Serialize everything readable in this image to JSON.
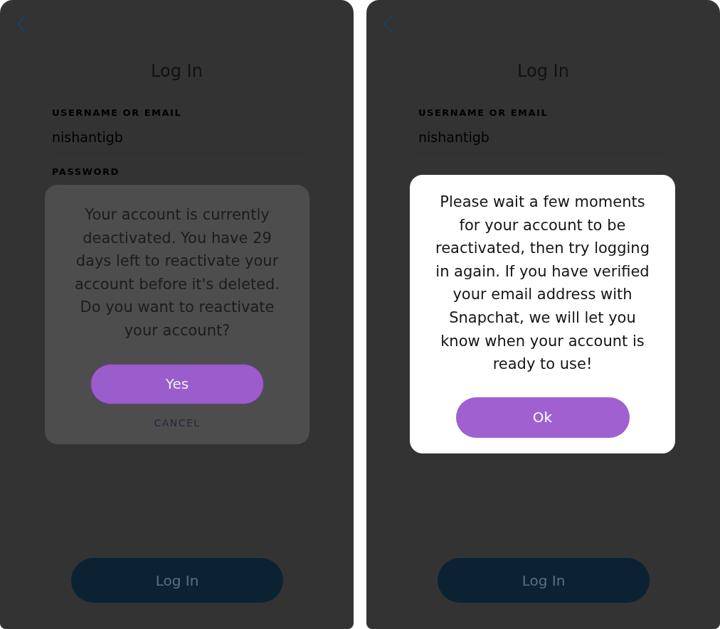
{
  "screens": [
    {
      "title": "Log In",
      "username_label": "USERNAME OR EMAIL",
      "username": "nishantigb",
      "password_label": "PASSWORD",
      "login_button": "Log In",
      "dialog": {
        "kind": "dimmed",
        "message": "Your account is currently deactivated. You have 29 days left to reactivate your account before it's deleted. Do you want to reactivate your account?",
        "primary_button": "Yes",
        "secondary_button": "CANCEL"
      }
    },
    {
      "title": "Log In",
      "username_label": "USERNAME OR EMAIL",
      "username": "nishantigb",
      "login_button": "Log In",
      "dialog": {
        "kind": "light",
        "message": "Please wait a few moments for your account to be reactivated, then try logging in again. If you have verified your email address with Snapchat, we will let you know when your account is ready to use!",
        "primary_button": "Ok"
      }
    }
  ]
}
